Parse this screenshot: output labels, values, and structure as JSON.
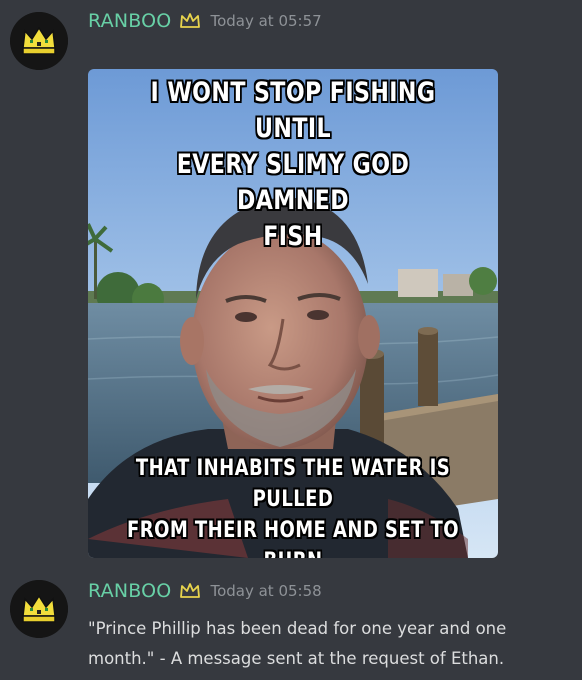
{
  "messages": [
    {
      "username": "RANBOO",
      "timestamp": "Today at 05:57",
      "avatar_icon": "crown-avatar-icon",
      "badge_icon": "crown-icon",
      "attachment": {
        "type": "meme-image",
        "top_caption": "I WONT STOP FISHING UNTIL\nEVERY SLIMY GOD DAMNED\nFISH",
        "bottom_caption": "THAT INHABITS THE WATER IS PULLED\nFROM THEIR HOME AND SET TO BURN\nUPON THE FLAMES THAT IS MY GRILL"
      }
    },
    {
      "username": "RANBOO",
      "timestamp": "Today at 05:58",
      "avatar_icon": "crown-avatar-icon",
      "badge_icon": "crown-icon",
      "text": "\"Prince Phillip has been dead for one year and one month.\" - A message sent at the request of Ethan."
    }
  ],
  "colors": {
    "background": "#36393f",
    "username": "#68d0a6",
    "timestamp": "#8e9297",
    "message_text": "#dcddde",
    "crown_gold": "#e8d44d"
  }
}
